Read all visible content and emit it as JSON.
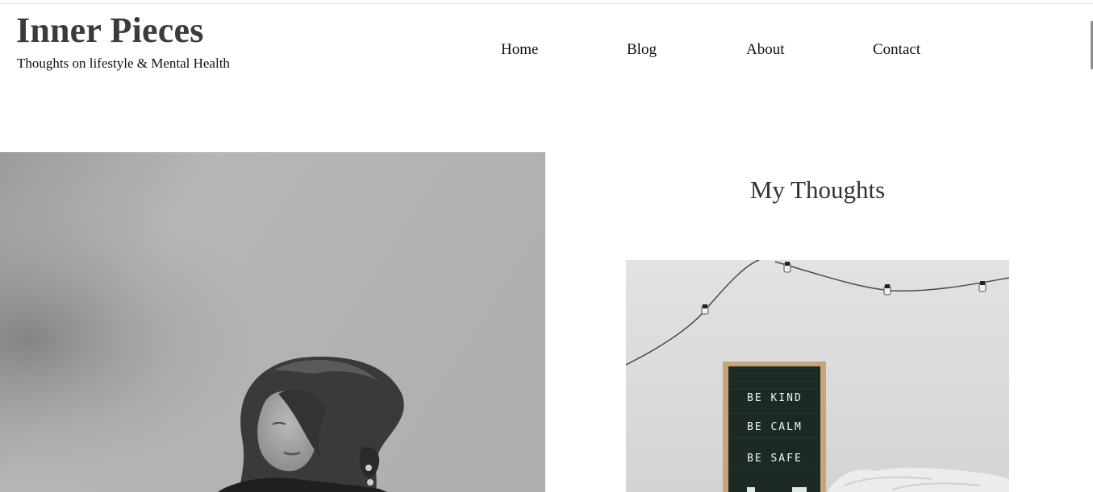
{
  "header": {
    "site_title": "Inner Pieces",
    "tagline": "Thoughts on lifestyle & Mental Health"
  },
  "nav": {
    "items": [
      {
        "label": "Home"
      },
      {
        "label": "Blog"
      },
      {
        "label": "About"
      },
      {
        "label": "Contact"
      }
    ]
  },
  "main": {
    "section_title": "My Thoughts",
    "letter_board": {
      "lines": [
        "BE  KIND",
        "BE  CALM",
        "BE  SAFE"
      ]
    }
  },
  "colors": {
    "title_text": "#3b3b3b",
    "body_text": "#111111",
    "background": "#ffffff"
  }
}
